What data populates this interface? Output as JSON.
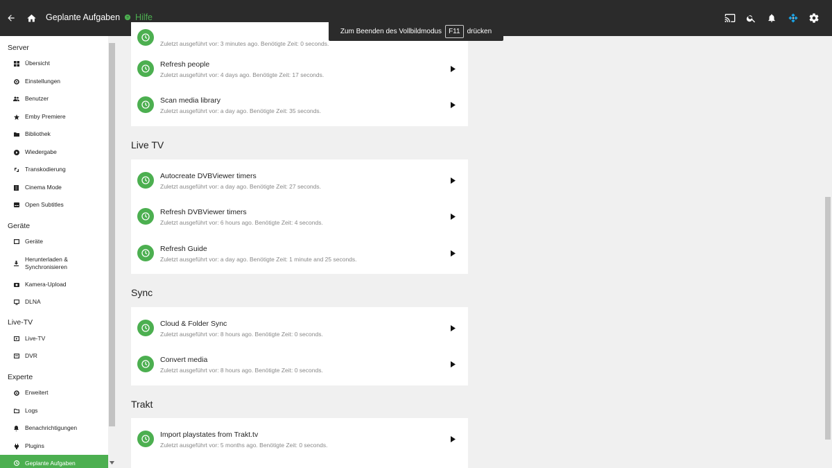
{
  "header": {
    "title": "Geplante Aufgaben",
    "help_label": "Hilfe",
    "fullscreen_prefix": "Zum Beenden des Vollbildmodus",
    "fullscreen_key": "F11",
    "fullscreen_suffix": "drücken"
  },
  "sidebar": {
    "sections": [
      {
        "title": "Server",
        "items": [
          "Übersicht",
          "Einstellungen",
          "Benutzer",
          "Emby Premiere",
          "Bibliothek",
          "Wiedergabe",
          "Transkodierung",
          "Cinema Mode",
          "Open Subtitles"
        ]
      },
      {
        "title": "Geräte",
        "items": [
          "Geräte",
          "Herunterladen &",
          "Synchronisieren",
          "Kamera-Upload",
          "DLNA"
        ]
      },
      {
        "title": "Live-TV",
        "items": [
          "Live-TV",
          "DVR"
        ]
      },
      {
        "title": "Experte",
        "items": [
          "Erweitert",
          "Logs",
          "Benachrichtigungen",
          "Plugins",
          "Geplante Aufgaben"
        ]
      }
    ]
  },
  "tasks": {
    "top": [
      {
        "name": "",
        "meta": "Zuletzt ausgeführt vor: 3 minutes ago. Benötigte Zeit: 0 seconds."
      },
      {
        "name": "Refresh people",
        "meta": "Zuletzt ausgeführt vor: 4 days ago. Benötigte Zeit: 17 seconds."
      },
      {
        "name": "Scan media library",
        "meta": "Zuletzt ausgeführt vor: a day ago. Benötigte Zeit: 35 seconds."
      }
    ],
    "livetv_title": "Live TV",
    "livetv": [
      {
        "name": "Autocreate DVBViewer timers",
        "meta": "Zuletzt ausgeführt vor: a day ago. Benötigte Zeit: 27 seconds."
      },
      {
        "name": "Refresh DVBViewer timers",
        "meta": "Zuletzt ausgeführt vor: 6 hours ago. Benötigte Zeit: 4 seconds."
      },
      {
        "name": "Refresh Guide",
        "meta": "Zuletzt ausgeführt vor: a day ago. Benötigte Zeit: 1 minute and 25 seconds."
      }
    ],
    "sync_title": "Sync",
    "sync": [
      {
        "name": "Cloud & Folder Sync",
        "meta": "Zuletzt ausgeführt vor: 8 hours ago. Benötigte Zeit: 0 seconds."
      },
      {
        "name": "Convert media",
        "meta": "Zuletzt ausgeführt vor: 8 hours ago. Benötigte Zeit: 0 seconds."
      }
    ],
    "trakt_title": "Trakt",
    "trakt": [
      {
        "name": "Import playstates from Trakt.tv",
        "meta": "Zuletzt ausgeführt vor: 5 months ago. Benötigte Zeit: 0 seconds."
      }
    ]
  },
  "colors": {
    "accent": "#4caf50",
    "topbar": "#2b2b2b",
    "background": "#f0f0f0"
  }
}
